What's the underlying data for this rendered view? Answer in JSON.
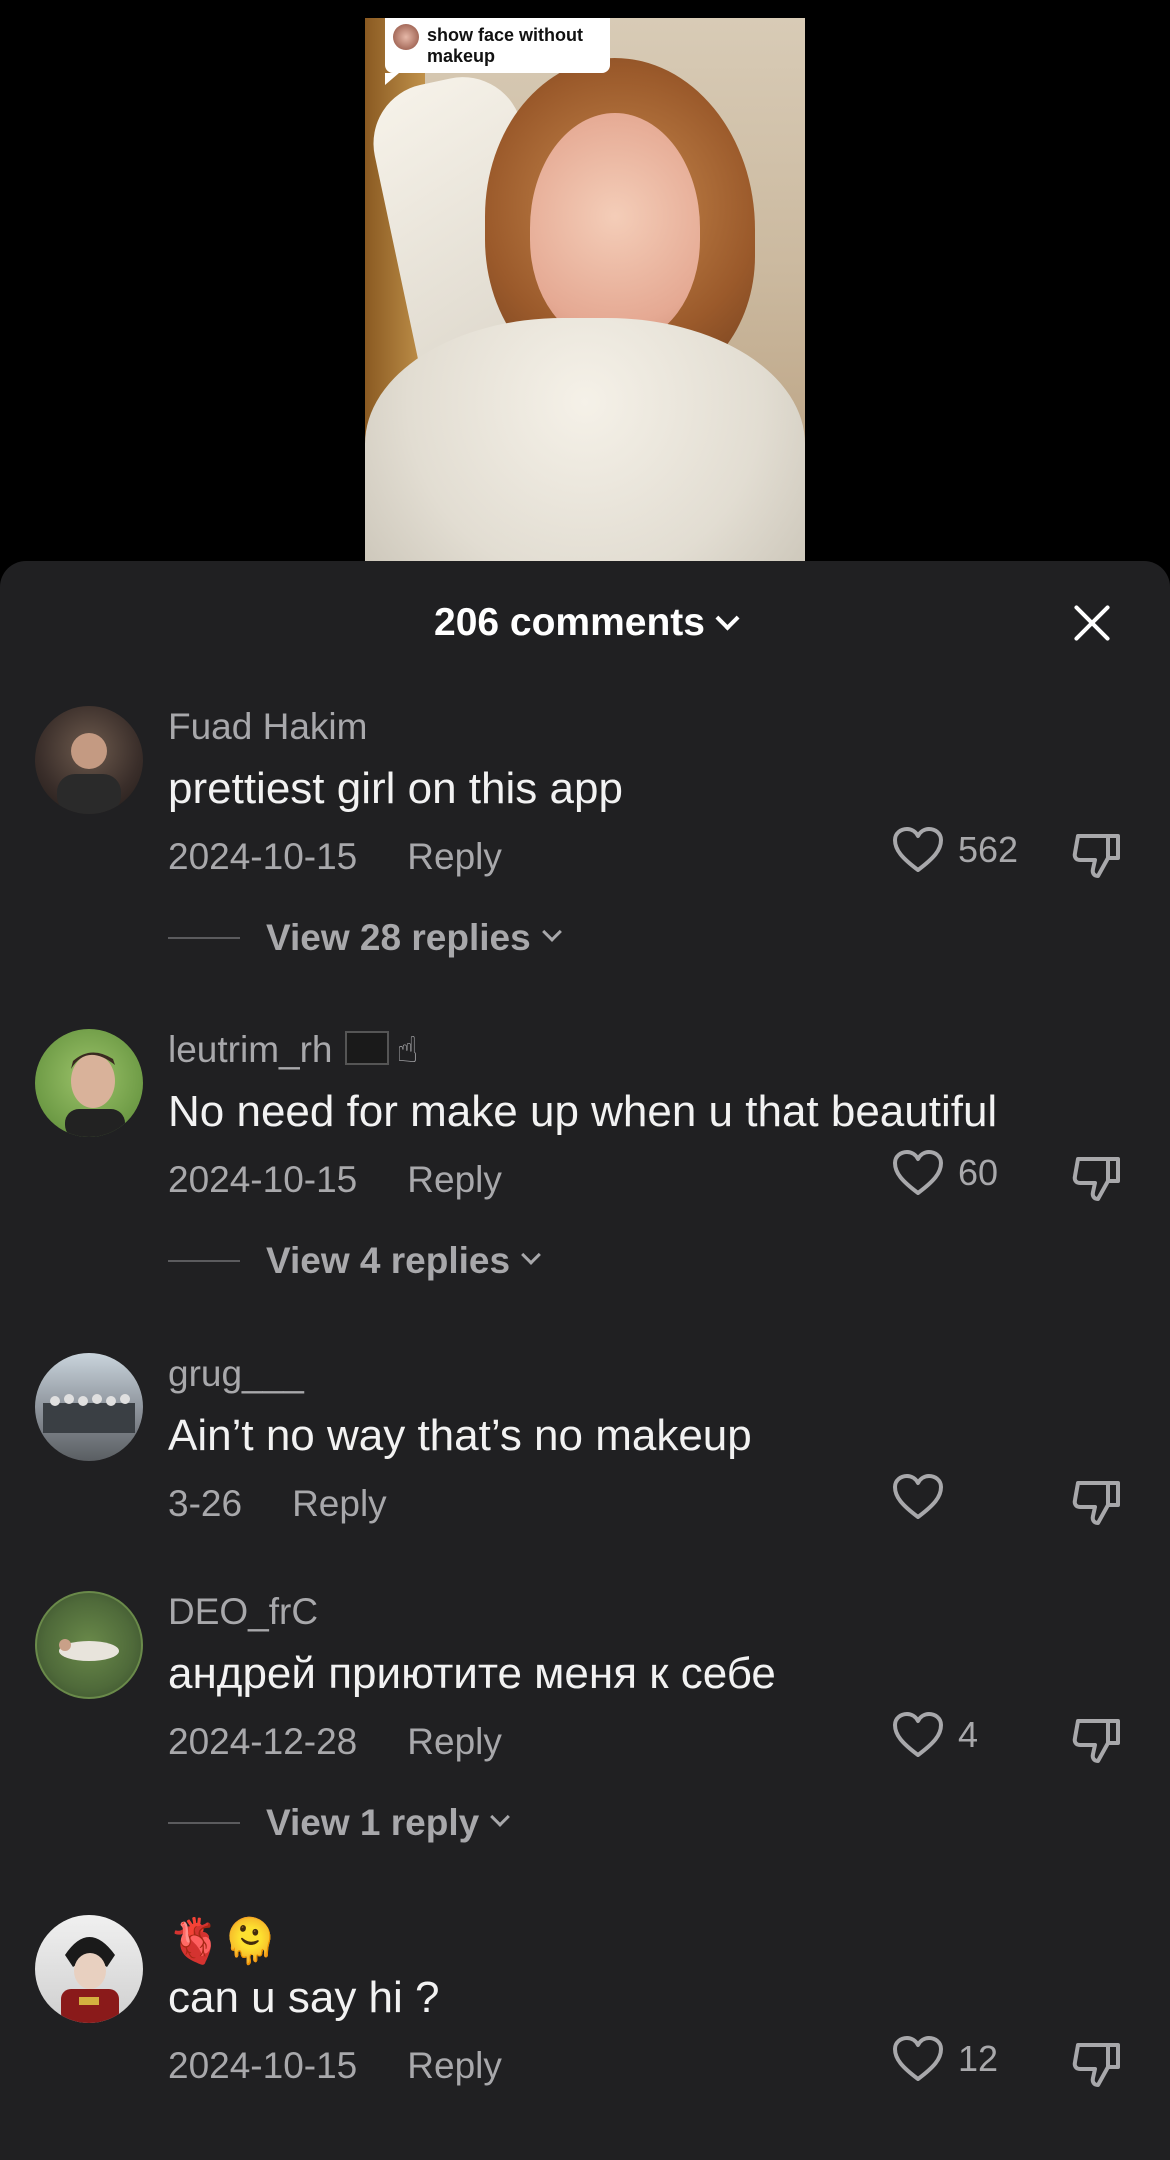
{
  "video": {
    "caption": "show face without makeup"
  },
  "sheet": {
    "title": "206 comments"
  },
  "comments": [
    {
      "username": "Fuad Hakim",
      "text": "prettiest girl on this app",
      "date": "2024-10-15",
      "reply_label": "Reply",
      "likes": "562",
      "view_replies": "View 28 replies",
      "avatar_color": "#3a2e2a"
    },
    {
      "username": "leutrim_rh",
      "username_emojis": "🏴☝🏻",
      "text": "No need for make up when u that beautiful",
      "date": "2024-10-15",
      "reply_label": "Reply",
      "likes": "60",
      "view_replies": "View 4 replies",
      "avatar_color": "#7fa85a"
    },
    {
      "username": "grug___",
      "text": "Ain’t no way that’s no makeup",
      "date": "3-26",
      "reply_label": "Reply",
      "likes": "",
      "avatar_color": "#8a9098"
    },
    {
      "username": "DEO_frC",
      "text": "андрей приютите меня к себе",
      "date": "2024-12-28",
      "reply_label": "Reply",
      "likes": "4",
      "view_replies": "View 1 reply",
      "avatar_color": "#4f6a3a"
    },
    {
      "username": "🫀🫠",
      "text": "can u say hi ?",
      "date": "2024-10-15",
      "reply_label": "Reply",
      "likes": "12",
      "avatar_color": "#d8d8d8"
    }
  ],
  "icons": {
    "like": "heart-outline-icon",
    "dislike": "thumbs-down-icon",
    "close": "close-icon",
    "chevron": "chevron-down-icon"
  }
}
